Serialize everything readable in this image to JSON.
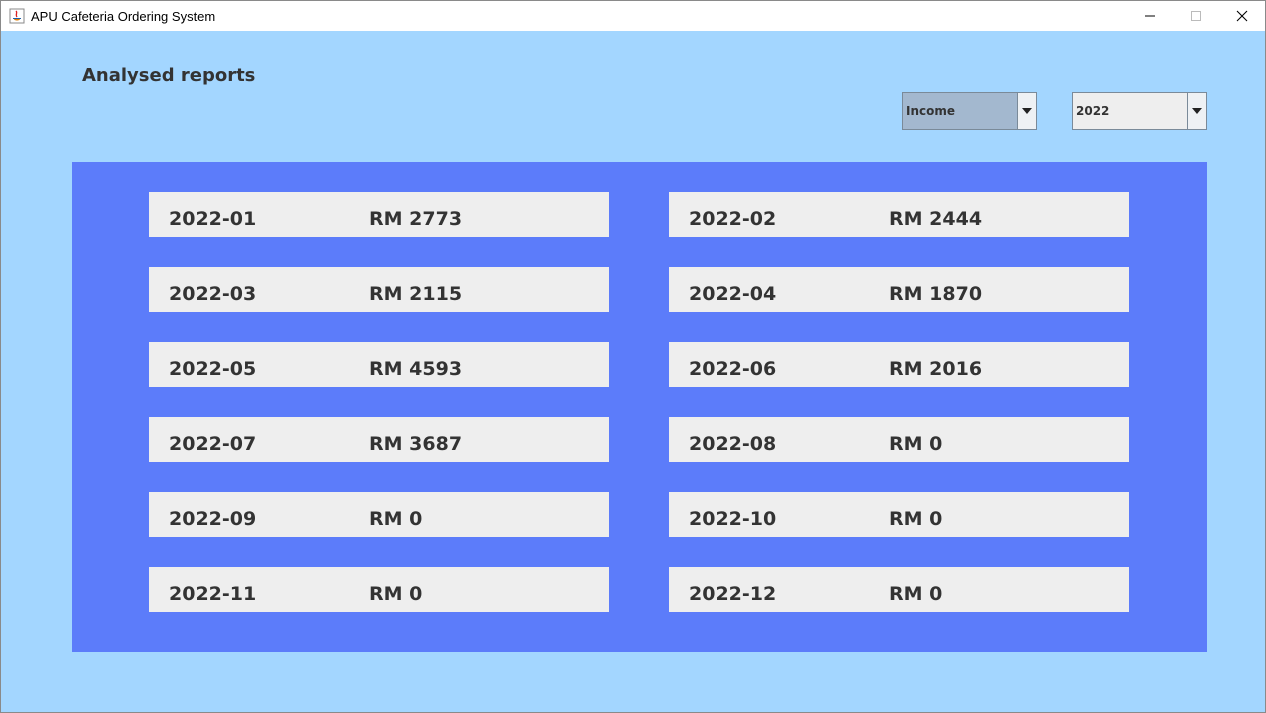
{
  "window": {
    "title": "APU Cafeteria Ordering System",
    "icon": "java-app-icon"
  },
  "page": {
    "title": "Analysed reports"
  },
  "filters": {
    "report_type": {
      "selected": "Income"
    },
    "year": {
      "selected": "2022"
    }
  },
  "reports": [
    {
      "month": "2022-01",
      "amount": "RM 2773"
    },
    {
      "month": "2022-02",
      "amount": "RM 2444"
    },
    {
      "month": "2022-03",
      "amount": "RM 2115"
    },
    {
      "month": "2022-04",
      "amount": "RM 1870"
    },
    {
      "month": "2022-05",
      "amount": "RM 4593"
    },
    {
      "month": "2022-06",
      "amount": "RM 2016"
    },
    {
      "month": "2022-07",
      "amount": "RM 3687"
    },
    {
      "month": "2022-08",
      "amount": "RM 0"
    },
    {
      "month": "2022-09",
      "amount": "RM 0"
    },
    {
      "month": "2022-10",
      "amount": "RM 0"
    },
    {
      "month": "2022-11",
      "amount": "RM 0"
    },
    {
      "month": "2022-12",
      "amount": "RM 0"
    }
  ],
  "colors": {
    "background": "#a3d6ff",
    "panel": "#5c7cfa",
    "card": "#eeeeee",
    "text": "#333333"
  }
}
